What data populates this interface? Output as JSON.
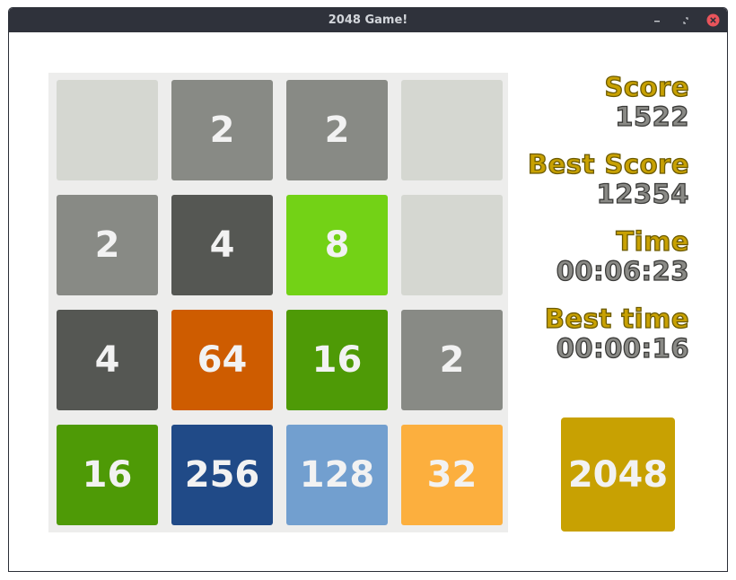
{
  "window": {
    "title": "2048 Game!"
  },
  "board": {
    "tiles": [
      {
        "value": "",
        "color": "#d5d7d1"
      },
      {
        "value": "2",
        "color": "#888a85"
      },
      {
        "value": "2",
        "color": "#888a85"
      },
      {
        "value": "",
        "color": "#d5d7d1"
      },
      {
        "value": "2",
        "color": "#888a85"
      },
      {
        "value": "4",
        "color": "#555753"
      },
      {
        "value": "8",
        "color": "#73d216"
      },
      {
        "value": "",
        "color": "#d5d7d1"
      },
      {
        "value": "4",
        "color": "#555753"
      },
      {
        "value": "64",
        "color": "#ce5c00"
      },
      {
        "value": "16",
        "color": "#4e9a06"
      },
      {
        "value": "2",
        "color": "#888a85"
      },
      {
        "value": "16",
        "color": "#4e9a06"
      },
      {
        "value": "256",
        "color": "#204a87"
      },
      {
        "value": "128",
        "color": "#729fcf"
      },
      {
        "value": "32",
        "color": "#fcaf3e"
      }
    ]
  },
  "stats": {
    "score_label": "Score",
    "score_value": "1522",
    "best_score_label": "Best Score",
    "best_score_value": "12354",
    "time_label": "Time",
    "time_value": "00:06:23",
    "best_time_label": "Best time",
    "best_time_value": "00:00:16"
  },
  "goal": {
    "value": "2048",
    "color": "#c4a000"
  },
  "icons": {
    "minimize": "minimize-icon",
    "maximize": "maximize-icon",
    "close": "close-icon"
  }
}
